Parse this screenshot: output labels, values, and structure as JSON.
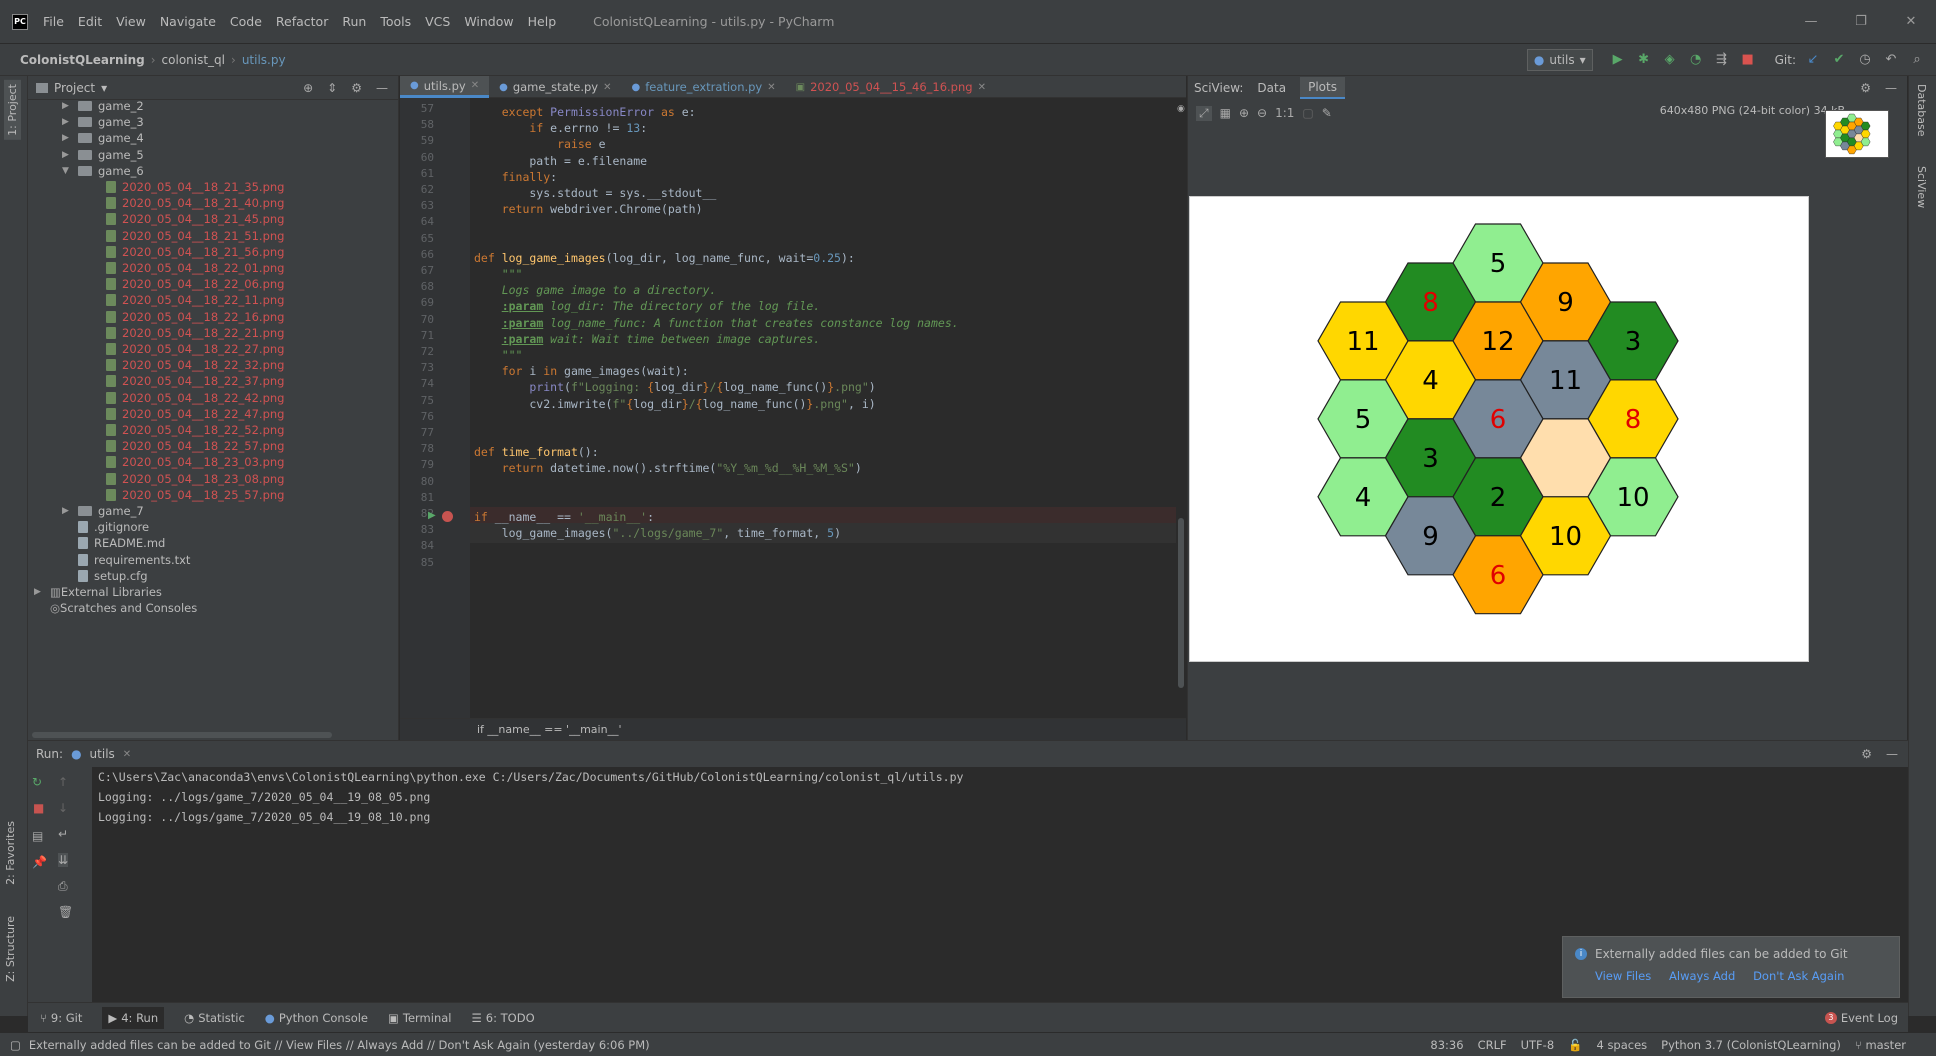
{
  "app": {
    "logo": "PC",
    "window_title": "ColonistQLearning - utils.py - PyCharm",
    "menu": [
      "File",
      "Edit",
      "View",
      "Navigate",
      "Code",
      "Refactor",
      "Run",
      "Tools",
      "VCS",
      "Window",
      "Help"
    ],
    "window_controls": [
      "—",
      "❐",
      "✕"
    ]
  },
  "navbar": {
    "breadcrumbs": [
      "ColonistQLearning",
      "colonist_ql",
      "utils.py"
    ],
    "run_config": "utils",
    "git_label": "Git:"
  },
  "left_tabs": [
    "1: Project",
    "2: Favorites",
    "Z: Structure"
  ],
  "right_tabs": [
    "Database",
    "SciView"
  ],
  "project": {
    "title": "Project",
    "tree": [
      {
        "label": "game_2",
        "type": "folder",
        "depth": 1,
        "state": "collapsed"
      },
      {
        "label": "game_3",
        "type": "folder",
        "depth": 1,
        "state": "collapsed"
      },
      {
        "label": "game_4",
        "type": "folder",
        "depth": 1,
        "state": "collapsed"
      },
      {
        "label": "game_5",
        "type": "folder",
        "depth": 1,
        "state": "collapsed"
      },
      {
        "label": "game_6",
        "type": "folder",
        "depth": 1,
        "state": "expanded"
      },
      {
        "label": "2020_05_04__18_21_35.png",
        "type": "png",
        "depth": 2
      },
      {
        "label": "2020_05_04__18_21_40.png",
        "type": "png",
        "depth": 2
      },
      {
        "label": "2020_05_04__18_21_45.png",
        "type": "png",
        "depth": 2
      },
      {
        "label": "2020_05_04__18_21_51.png",
        "type": "png",
        "depth": 2
      },
      {
        "label": "2020_05_04__18_21_56.png",
        "type": "png",
        "depth": 2
      },
      {
        "label": "2020_05_04__18_22_01.png",
        "type": "png",
        "depth": 2
      },
      {
        "label": "2020_05_04__18_22_06.png",
        "type": "png",
        "depth": 2
      },
      {
        "label": "2020_05_04__18_22_11.png",
        "type": "png",
        "depth": 2
      },
      {
        "label": "2020_05_04__18_22_16.png",
        "type": "png",
        "depth": 2
      },
      {
        "label": "2020_05_04__18_22_21.png",
        "type": "png",
        "depth": 2
      },
      {
        "label": "2020_05_04__18_22_27.png",
        "type": "png",
        "depth": 2
      },
      {
        "label": "2020_05_04__18_22_32.png",
        "type": "png",
        "depth": 2
      },
      {
        "label": "2020_05_04__18_22_37.png",
        "type": "png",
        "depth": 2
      },
      {
        "label": "2020_05_04__18_22_42.png",
        "type": "png",
        "depth": 2
      },
      {
        "label": "2020_05_04__18_22_47.png",
        "type": "png",
        "depth": 2
      },
      {
        "label": "2020_05_04__18_22_52.png",
        "type": "png",
        "depth": 2
      },
      {
        "label": "2020_05_04__18_22_57.png",
        "type": "png",
        "depth": 2
      },
      {
        "label": "2020_05_04__18_23_03.png",
        "type": "png",
        "depth": 2
      },
      {
        "label": "2020_05_04__18_23_08.png",
        "type": "png",
        "depth": 2
      },
      {
        "label": "2020_05_04__18_25_57.png",
        "type": "png",
        "depth": 2
      },
      {
        "label": "game_7",
        "type": "folder",
        "depth": 1,
        "state": "collapsed"
      },
      {
        "label": ".gitignore",
        "type": "file",
        "depth": 1
      },
      {
        "label": "README.md",
        "type": "file",
        "depth": 1
      },
      {
        "label": "requirements.txt",
        "type": "file",
        "depth": 1
      },
      {
        "label": "setup.cfg",
        "type": "file",
        "depth": 1
      },
      {
        "label": "External Libraries",
        "type": "lib",
        "depth": 0,
        "state": "collapsed"
      },
      {
        "label": "Scratches and Consoles",
        "type": "scratch",
        "depth": 0
      }
    ]
  },
  "editor": {
    "tabs": [
      {
        "label": "utils.py",
        "active": true,
        "color": "#bbbbbb"
      },
      {
        "label": "game_state.py",
        "active": false,
        "color": "#bbbbbb"
      },
      {
        "label": "feature_extration.py",
        "active": false,
        "color": "#6897bb"
      },
      {
        "label": "2020_05_04__15_46_16.png",
        "active": false,
        "color": "#d05252"
      }
    ],
    "lines": [
      {
        "n": "57",
        "code": [
          [
            "    ",
            "plain"
          ],
          [
            "except ",
            "kw"
          ],
          [
            "PermissionError ",
            "bi"
          ],
          [
            "as ",
            "kw"
          ],
          [
            "e:",
            "plain"
          ]
        ]
      },
      {
        "n": "58",
        "code": [
          [
            "        ",
            "plain"
          ],
          [
            "if ",
            "kw"
          ],
          [
            "e.errno != ",
            "plain"
          ],
          [
            "13",
            "num"
          ],
          [
            ":",
            "plain"
          ]
        ]
      },
      {
        "n": "59",
        "code": [
          [
            "            ",
            "plain"
          ],
          [
            "raise ",
            "kw"
          ],
          [
            "e",
            "plain"
          ]
        ]
      },
      {
        "n": "60",
        "code": [
          [
            "        path = e.filename",
            "plain"
          ]
        ]
      },
      {
        "n": "61",
        "code": [
          [
            "    ",
            "plain"
          ],
          [
            "finally",
            "kw"
          ],
          [
            ":",
            "plain"
          ]
        ]
      },
      {
        "n": "62",
        "code": [
          [
            "        sys.stdout = sys.__stdout__",
            "plain"
          ]
        ]
      },
      {
        "n": "63",
        "code": [
          [
            "    ",
            "plain"
          ],
          [
            "return ",
            "kw"
          ],
          [
            "webdriver.Chrome(path)",
            "plain"
          ]
        ]
      },
      {
        "n": "64",
        "code": []
      },
      {
        "n": "65",
        "code": []
      },
      {
        "n": "66",
        "code": [
          [
            "def ",
            "kw"
          ],
          [
            "log_game_images",
            "fn"
          ],
          [
            "(log_dir, log_name_func, wait=",
            "plain"
          ],
          [
            "0.25",
            "num"
          ],
          [
            "):",
            "plain"
          ]
        ]
      },
      {
        "n": "67",
        "code": [
          [
            "    \"\"\"",
            "doc"
          ]
        ]
      },
      {
        "n": "68",
        "code": [
          [
            "    Logs game image to a directory.",
            "doc"
          ]
        ]
      },
      {
        "n": "69",
        "code": [
          [
            "    ",
            "doc"
          ],
          [
            ":param",
            "tag"
          ],
          [
            " log_dir: The directory of the log file.",
            "doc"
          ]
        ]
      },
      {
        "n": "70",
        "code": [
          [
            "    ",
            "doc"
          ],
          [
            ":param",
            "tag"
          ],
          [
            " log_name_func: A function that creates constance log names.",
            "doc"
          ]
        ]
      },
      {
        "n": "71",
        "code": [
          [
            "    ",
            "doc"
          ],
          [
            ":param",
            "tag"
          ],
          [
            " wait: Wait time between image captures.",
            "doc"
          ]
        ]
      },
      {
        "n": "72",
        "code": [
          [
            "    \"\"\"",
            "doc"
          ]
        ]
      },
      {
        "n": "73",
        "code": [
          [
            "    ",
            "plain"
          ],
          [
            "for ",
            "kw"
          ],
          [
            "i ",
            "plain"
          ],
          [
            "in ",
            "kw"
          ],
          [
            "game_images(wait):",
            "plain"
          ]
        ]
      },
      {
        "n": "74",
        "code": [
          [
            "        ",
            "plain"
          ],
          [
            "print",
            "bi"
          ],
          [
            "(",
            "plain"
          ],
          [
            "f\"Logging: ",
            "str"
          ],
          [
            "{",
            "sq"
          ],
          [
            "log_dir",
            "plain"
          ],
          [
            "}",
            "sq"
          ],
          [
            "/",
            "str"
          ],
          [
            "{",
            "sq"
          ],
          [
            "log_name_func()",
            "plain"
          ],
          [
            "}",
            "sq"
          ],
          [
            ".png\"",
            "str"
          ],
          [
            ")",
            "plain"
          ]
        ]
      },
      {
        "n": "75",
        "code": [
          [
            "        cv2.imwrite(",
            "plain"
          ],
          [
            "f\"",
            "str"
          ],
          [
            "{",
            "sq"
          ],
          [
            "log_dir",
            "plain"
          ],
          [
            "}",
            "sq"
          ],
          [
            "/",
            "str"
          ],
          [
            "{",
            "sq"
          ],
          [
            "log_name_func()",
            "plain"
          ],
          [
            "}",
            "sq"
          ],
          [
            ".png\"",
            "str"
          ],
          [
            ", i)",
            "plain"
          ]
        ]
      },
      {
        "n": "76",
        "code": []
      },
      {
        "n": "77",
        "code": []
      },
      {
        "n": "78",
        "code": [
          [
            "def ",
            "kw"
          ],
          [
            "time_format",
            "fn"
          ],
          [
            "():",
            "plain"
          ]
        ]
      },
      {
        "n": "79",
        "code": [
          [
            "    ",
            "plain"
          ],
          [
            "return ",
            "kw"
          ],
          [
            "datetime.now().strftime(",
            "plain"
          ],
          [
            "\"%Y_%m_%d__%H_%M_%S\"",
            "str"
          ],
          [
            ")",
            "plain"
          ]
        ]
      },
      {
        "n": "80",
        "code": []
      },
      {
        "n": "81",
        "code": []
      },
      {
        "n": "82",
        "code": [
          [
            "if ",
            "kw"
          ],
          [
            "__name__ == ",
            "plain"
          ],
          [
            "'__main__'",
            "str"
          ],
          [
            ":",
            "plain"
          ]
        ]
      },
      {
        "n": "83",
        "code": [
          [
            "    log_game_images(",
            "plain"
          ],
          [
            "\"../logs/game_7\"",
            "str"
          ],
          [
            ", time_format, ",
            "plain"
          ],
          [
            "5",
            "num"
          ],
          [
            ")",
            "plain"
          ]
        ]
      },
      {
        "n": "84",
        "code": []
      },
      {
        "n": "85",
        "code": []
      }
    ],
    "breadcrumb": "if __name__ == '__main__'"
  },
  "sciview": {
    "title": "SciView:",
    "tabs": [
      "Data",
      "Plots"
    ],
    "active_tab": "Plots",
    "zoom_label": "1:1",
    "image_info": "640x480 PNG (24-bit color) 34 kB",
    "board": {
      "colors": {
        "wood": "#228b22",
        "sheep": "#90ee90",
        "wheat": "#ffd700",
        "ore": "#778899",
        "brick": "#ffa500",
        "desert": "#ffdead"
      },
      "hexes": [
        {
          "col": 2,
          "row": 0,
          "res": "sheep",
          "num": "5",
          "red": false
        },
        {
          "col": 1,
          "row": 0.5,
          "res": "wood",
          "num": "8",
          "red": true
        },
        {
          "col": 3,
          "row": 0.5,
          "res": "brick",
          "num": "9",
          "red": false
        },
        {
          "col": 0,
          "row": 1,
          "res": "wheat",
          "num": "11",
          "red": false
        },
        {
          "col": 2,
          "row": 1,
          "res": "brick",
          "num": "12",
          "red": false
        },
        {
          "col": 4,
          "row": 1,
          "res": "wood",
          "num": "3",
          "red": false
        },
        {
          "col": 1,
          "row": 1.5,
          "res": "wheat",
          "num": "4",
          "red": false
        },
        {
          "col": 3,
          "row": 1.5,
          "res": "ore",
          "num": "11",
          "red": false
        },
        {
          "col": 0,
          "row": 2,
          "res": "sheep",
          "num": "5",
          "red": false
        },
        {
          "col": 2,
          "row": 2,
          "res": "ore",
          "num": "6",
          "red": true
        },
        {
          "col": 4,
          "row": 2,
          "res": "wheat",
          "num": "8",
          "red": true
        },
        {
          "col": 1,
          "row": 2.5,
          "res": "wood",
          "num": "3",
          "red": false
        },
        {
          "col": 3,
          "row": 2.5,
          "res": "desert",
          "num": "",
          "red": false
        },
        {
          "col": 0,
          "row": 3,
          "res": "sheep",
          "num": "4",
          "red": false
        },
        {
          "col": 2,
          "row": 3,
          "res": "wood",
          "num": "2",
          "red": false
        },
        {
          "col": 4,
          "row": 3,
          "res": "sheep",
          "num": "10",
          "red": false
        },
        {
          "col": 1,
          "row": 3.5,
          "res": "ore",
          "num": "9",
          "red": false
        },
        {
          "col": 3,
          "row": 3.5,
          "res": "wheat",
          "num": "10",
          "red": false
        },
        {
          "col": 2,
          "row": 4,
          "res": "brick",
          "num": "6",
          "red": true
        }
      ]
    }
  },
  "run": {
    "label": "Run:",
    "tab": "utils",
    "console": [
      "C:\\Users\\Zac\\anaconda3\\envs\\ColonistQLearning\\python.exe C:/Users/Zac/Documents/GitHub/ColonistQLearning/colonist_ql/utils.py",
      "Logging: ../logs/game_7/2020_05_04__19_08_05.png",
      "Logging: ../logs/game_7/2020_05_04__19_08_10.png"
    ]
  },
  "tool_windows": [
    "9: Git",
    "4: Run",
    "Statistic",
    "Python Console",
    "Terminal",
    "6: TODO"
  ],
  "event_log": {
    "label": "Event Log",
    "count": "3"
  },
  "notification": {
    "text": "Externally added files can be added to Git",
    "actions": [
      "View Files",
      "Always Add",
      "Don't Ask Again"
    ]
  },
  "status": {
    "message": "Externally added files can be added to Git // View Files // Always Add // Don't Ask Again (yesterday 6:06 PM)",
    "position": "83:36",
    "line_sep": "CRLF",
    "encoding": "UTF-8",
    "indent": "4 spaces",
    "interpreter": "Python 3.7 (ColonistQLearning)",
    "branch": "master"
  }
}
